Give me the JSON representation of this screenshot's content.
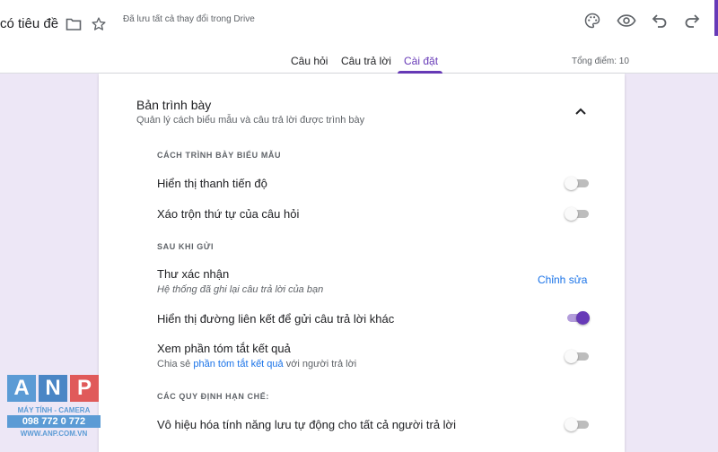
{
  "header": {
    "doc_title": "có tiêu đề",
    "saved_status": "Đã lưu tất cả thay đổi trong Drive",
    "icons": [
      "folder-icon",
      "star-icon",
      "palette-icon",
      "eye-icon",
      "undo-icon",
      "redo-icon"
    ]
  },
  "tabs": [
    {
      "label": "Câu hỏi",
      "active": false
    },
    {
      "label": "Câu trả lời",
      "active": false
    },
    {
      "label": "Cài đặt",
      "active": true
    }
  ],
  "total_points": "Tổng điểm: 10",
  "colors": {
    "accent": "#673ab7",
    "link": "#1a73e8",
    "background": "#ede7f6"
  },
  "section": {
    "title": "Bản trình bày",
    "subtitle": "Quản lý cách biểu mẫu và câu trả lời được trình bày"
  },
  "groups": {
    "form_presentation": "CÁCH TRÌNH BÀY BIỂU MẪU",
    "after_submit": "SAU KHI GỬI",
    "restrictions": "CÁC QUY ĐỊNH HẠN CHẾ:"
  },
  "settings": {
    "progress_bar": {
      "label": "Hiển thị thanh tiến độ",
      "on": false
    },
    "shuffle": {
      "label": "Xáo trộn thứ tự của câu hỏi",
      "on": false
    },
    "confirmation": {
      "label": "Thư xác nhận",
      "sub": "Hệ thống đã ghi lại câu trả lời của bạn",
      "edit": "Chỉnh sửa"
    },
    "resubmit_link": {
      "label": "Hiển thị đường liên kết để gửi câu trả lời khác",
      "on": true
    },
    "summary": {
      "label": "Xem phần tóm tắt kết quả",
      "sub_prefix": "Chia sẻ ",
      "sub_link": "phần tóm tắt kết quả",
      "sub_suffix": " với người trả lời",
      "on": false
    },
    "autosave": {
      "label": "Vô hiệu hóa tính năng lưu tự động cho tất cả người trả lời",
      "on": false
    }
  },
  "watermark": {
    "letters": [
      "A",
      "N",
      "P"
    ],
    "line1": "MÁY TÍNH - CAMERA",
    "line2": "098 772 0 772",
    "line3": "WWW.ANP.COM.VN"
  }
}
